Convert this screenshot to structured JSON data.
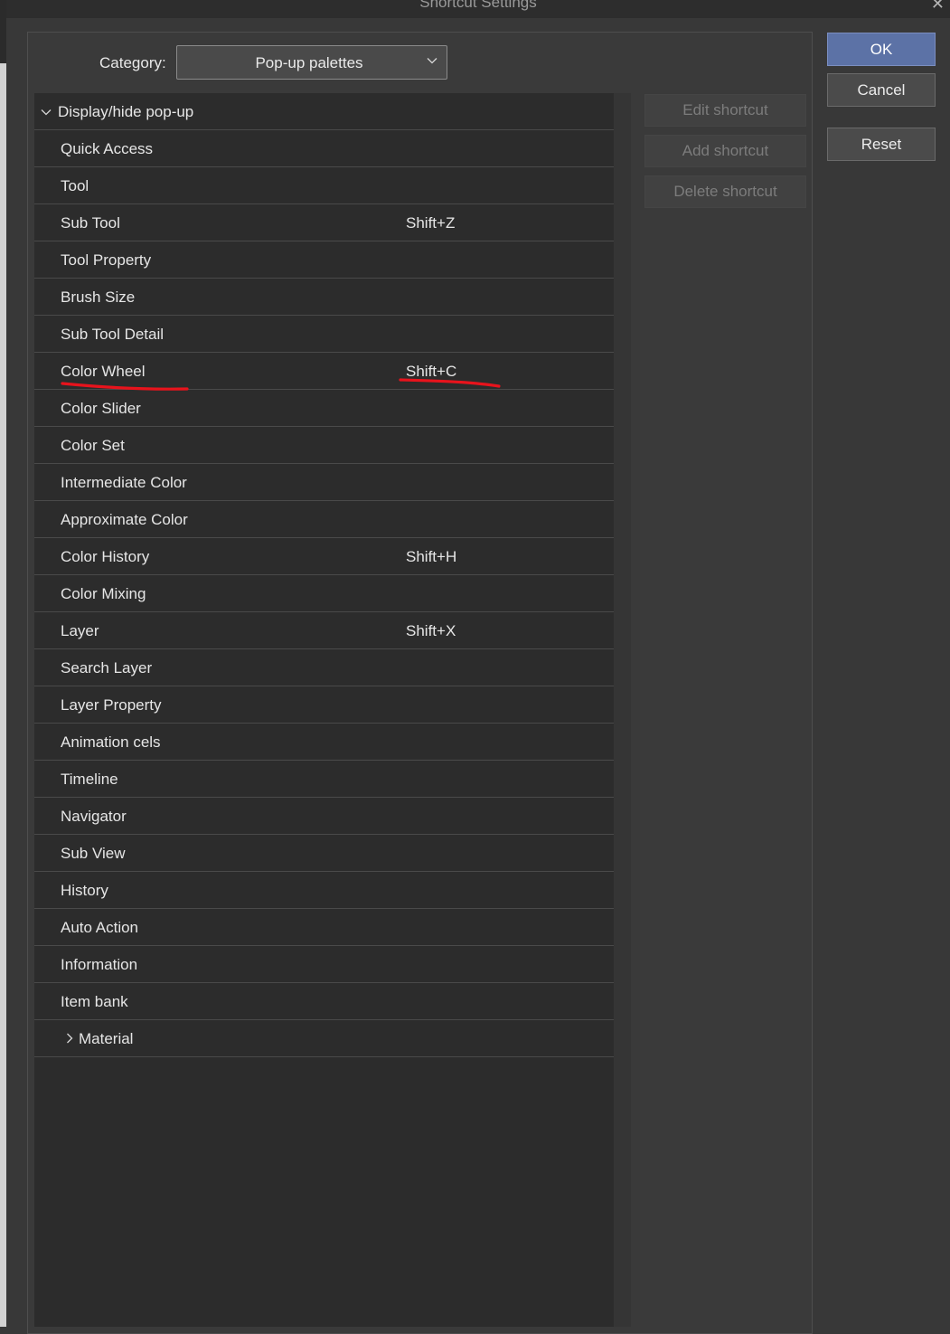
{
  "window": {
    "title": "Shortcut Settings"
  },
  "category": {
    "label": "Category:",
    "value": "Pop-up palettes"
  },
  "tree": {
    "parent": {
      "label": "Display/hide pop-up"
    },
    "items": [
      {
        "label": "Quick Access",
        "shortcut": ""
      },
      {
        "label": "Tool",
        "shortcut": ""
      },
      {
        "label": "Sub Tool",
        "shortcut": "Shift+Z"
      },
      {
        "label": "Tool Property",
        "shortcut": ""
      },
      {
        "label": "Brush Size",
        "shortcut": ""
      },
      {
        "label": "Sub Tool Detail",
        "shortcut": ""
      },
      {
        "label": "Color Wheel",
        "shortcut": "Shift+C"
      },
      {
        "label": "Color Slider",
        "shortcut": ""
      },
      {
        "label": "Color Set",
        "shortcut": ""
      },
      {
        "label": "Intermediate Color",
        "shortcut": ""
      },
      {
        "label": "Approximate Color",
        "shortcut": ""
      },
      {
        "label": "Color History",
        "shortcut": "Shift+H"
      },
      {
        "label": "Color Mixing",
        "shortcut": ""
      },
      {
        "label": "Layer",
        "shortcut": "Shift+X"
      },
      {
        "label": "Search Layer",
        "shortcut": ""
      },
      {
        "label": "Layer Property",
        "shortcut": ""
      },
      {
        "label": "Animation cels",
        "shortcut": ""
      },
      {
        "label": "Timeline",
        "shortcut": ""
      },
      {
        "label": "Navigator",
        "shortcut": ""
      },
      {
        "label": "Sub View",
        "shortcut": ""
      },
      {
        "label": "History",
        "shortcut": ""
      },
      {
        "label": "Auto Action",
        "shortcut": ""
      },
      {
        "label": "Information",
        "shortcut": ""
      },
      {
        "label": "Item bank",
        "shortcut": ""
      }
    ],
    "material": {
      "label": "Material"
    }
  },
  "side_buttons": {
    "edit": "Edit shortcut",
    "add": "Add shortcut",
    "delete": "Delete shortcut"
  },
  "dialog_buttons": {
    "ok": "OK",
    "cancel": "Cancel",
    "reset": "Reset"
  },
  "colors": {
    "accent": "#5c72a6",
    "annotation": "#e8131c"
  }
}
